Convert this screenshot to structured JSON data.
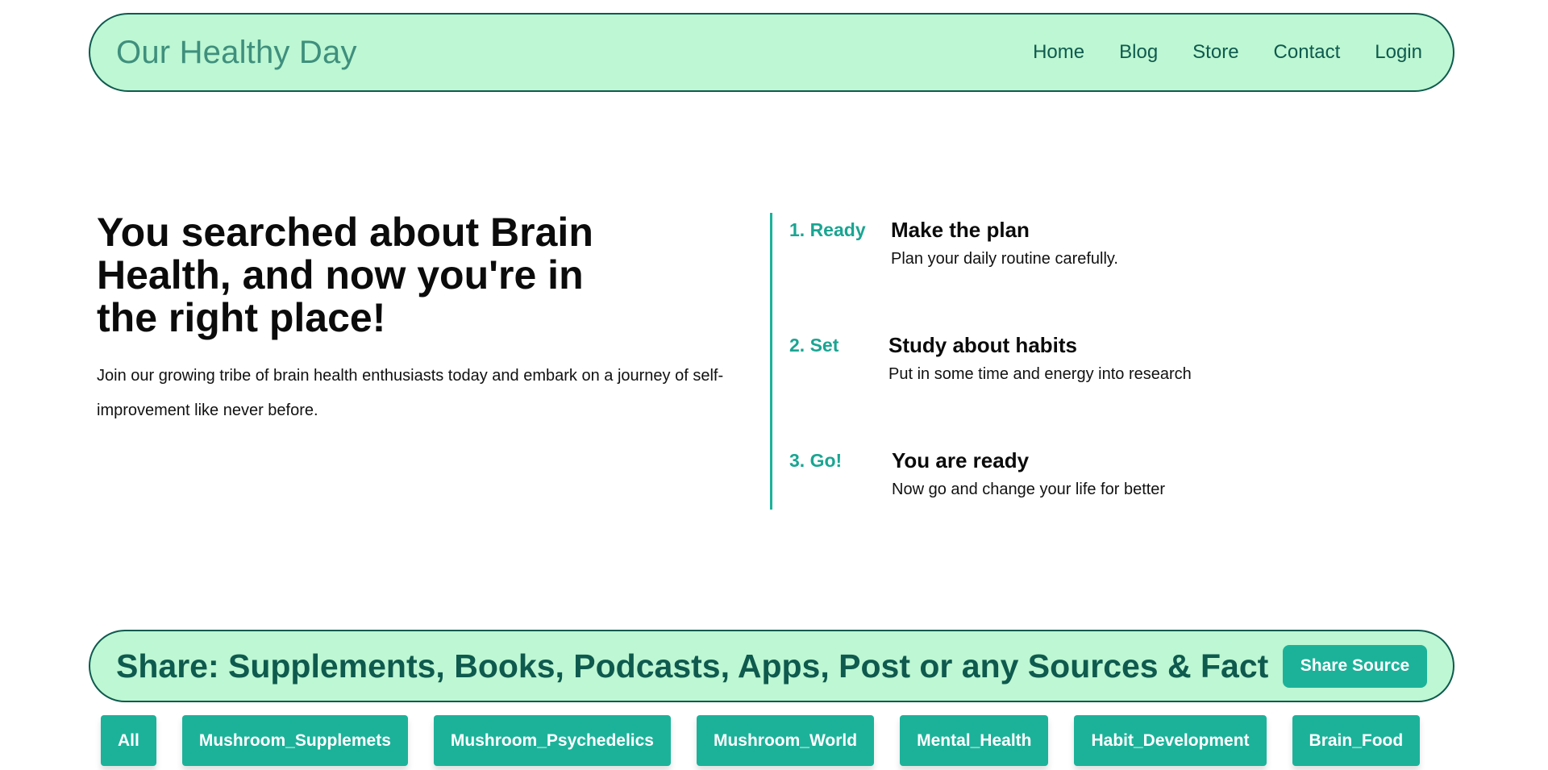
{
  "header": {
    "brand": "Our Healthy Day",
    "nav": [
      "Home",
      "Blog",
      "Store",
      "Contact",
      "Login"
    ]
  },
  "hero": {
    "title": "You searched about Brain Health, and now you're in the right place!",
    "text": "Join our growing tribe of brain health enthusiasts today and embark on a journey of self-improvement like never before."
  },
  "steps": [
    {
      "num": "1. Ready",
      "title": "Make the plan",
      "desc": "Plan your daily routine carefully."
    },
    {
      "num": "2. Set",
      "title": "Study about habits",
      "desc": "Put in some time and energy into research"
    },
    {
      "num": "3. Go!",
      "title": "You are ready",
      "desc": "Now go and change your life for better"
    }
  ],
  "share": {
    "title": "Share: Supplements, Books, Podcasts, Apps, Post or any Sources & Fact",
    "button": "Share Source"
  },
  "filters": [
    "All",
    "Mushroom_Supplemets",
    "Mushroom_Psychedelics",
    "Mushroom_World",
    "Mental_Health",
    "Habit_Development",
    "Brain_Food"
  ],
  "colors": {
    "mint": "#bdf7d3",
    "dark_teal": "#0f5a4e",
    "accent": "#1cb29a"
  }
}
